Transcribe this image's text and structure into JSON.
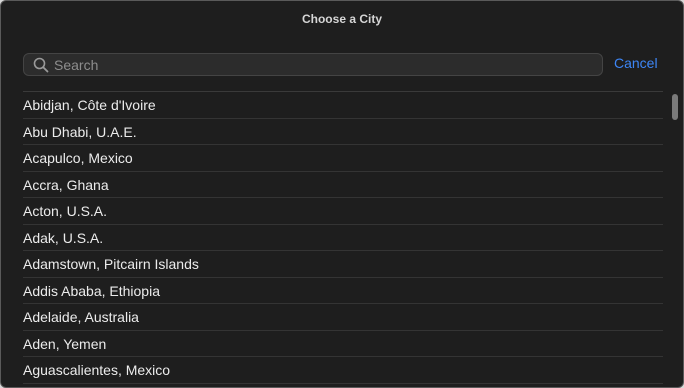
{
  "dialog": {
    "title": "Choose a City"
  },
  "search": {
    "placeholder": "Search",
    "value": "",
    "icon": "search-icon"
  },
  "cancel_label": "Cancel",
  "cities": [
    "Abidjan, Côte d'Ivoire",
    "Abu Dhabi, U.A.E.",
    "Acapulco, Mexico",
    "Accra, Ghana",
    "Acton, U.S.A.",
    "Adak, U.S.A.",
    "Adamstown, Pitcairn Islands",
    "Addis Ababa, Ethiopia",
    "Adelaide, Australia",
    "Aden, Yemen",
    "Aguascalientes, Mexico"
  ],
  "colors": {
    "background": "#1e1e1e",
    "accent": "#3d86f6",
    "text": "#ececec"
  }
}
